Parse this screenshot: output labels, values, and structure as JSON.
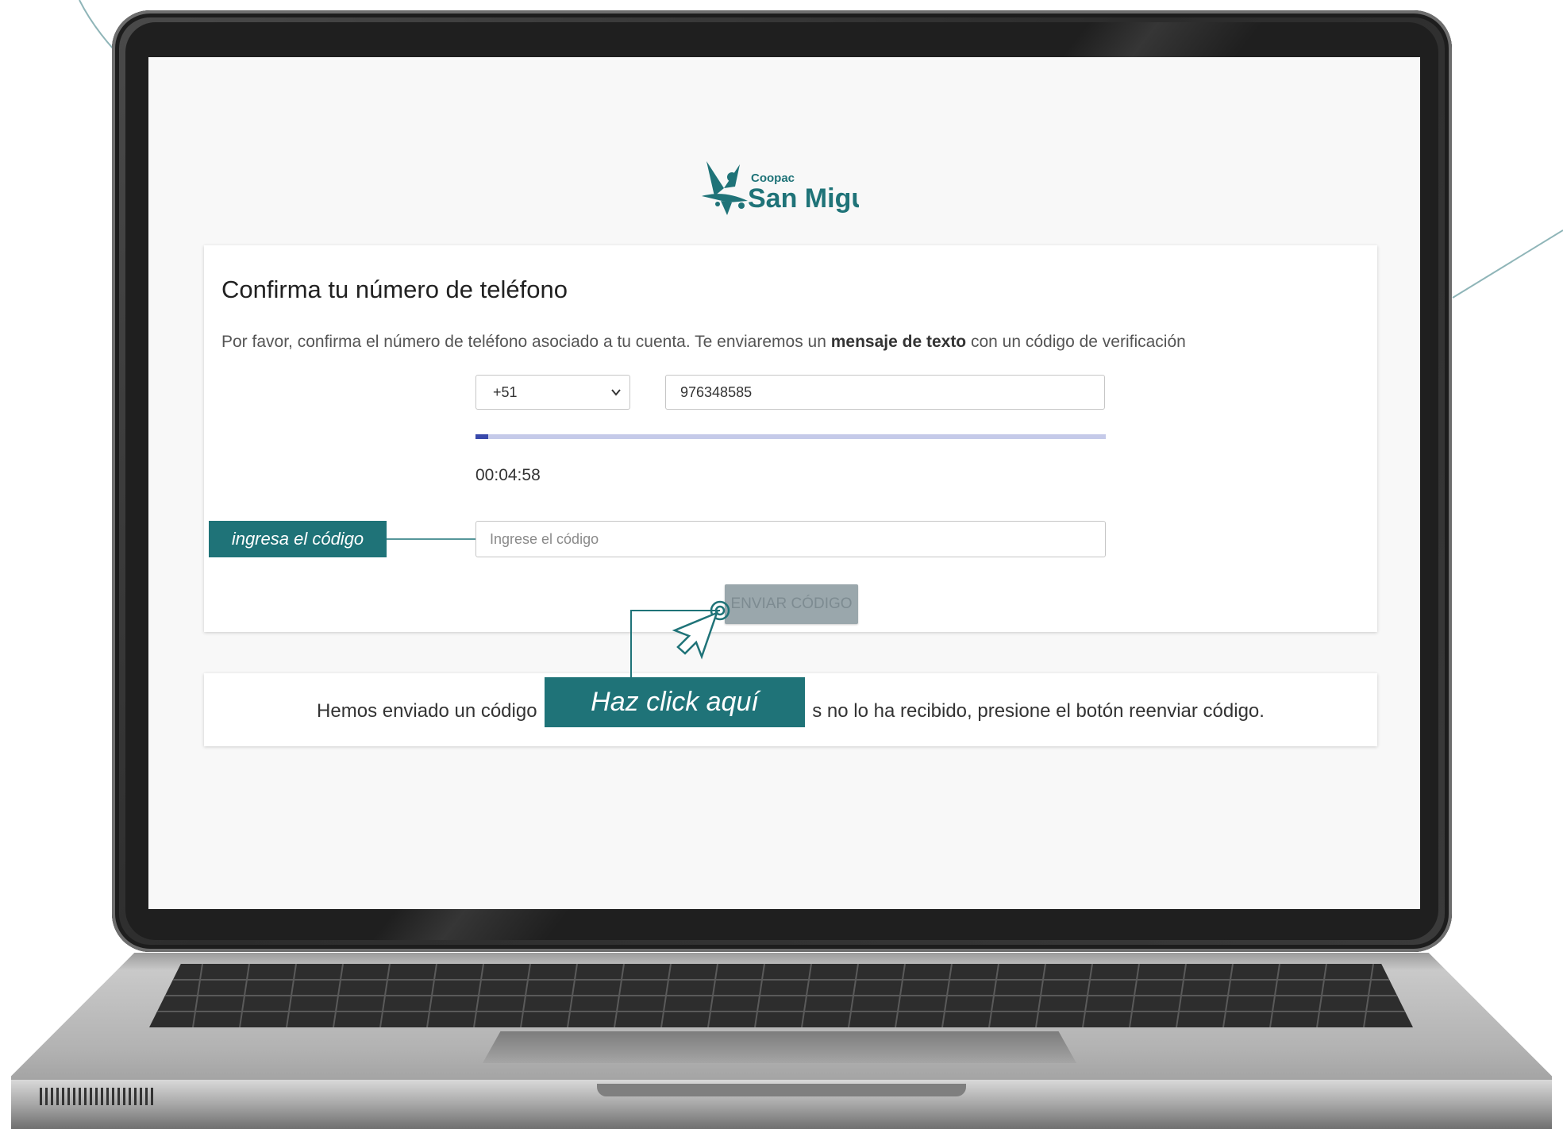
{
  "brand": {
    "name_top": "Coopac",
    "name_main": "San Miguel",
    "primary_color": "#1f7378"
  },
  "form": {
    "title": "Confirma tu número de teléfono",
    "description_before": "Por favor, confirma el número de teléfono asociado a tu cuenta. Te enviaremos un ",
    "description_bold": "mensaje de texto",
    "description_after": " con un código de verificación",
    "country_code": "+51",
    "phone_value": "976348585",
    "progress_fraction": 0.02,
    "timer": "00:04:58",
    "code_placeholder": "Ingrese el código",
    "send_button_label": "ENVIAR CÓDIGO"
  },
  "notice": {
    "text_before": "Hemos enviado un código ",
    "text_after": "s no lo ha recibido, presione el botón reenviar código."
  },
  "tutorial": {
    "code_hint": "ingresa el código",
    "click_hint": "Haz click aquí",
    "cursor_icon": "pointer-cursor-icon"
  }
}
